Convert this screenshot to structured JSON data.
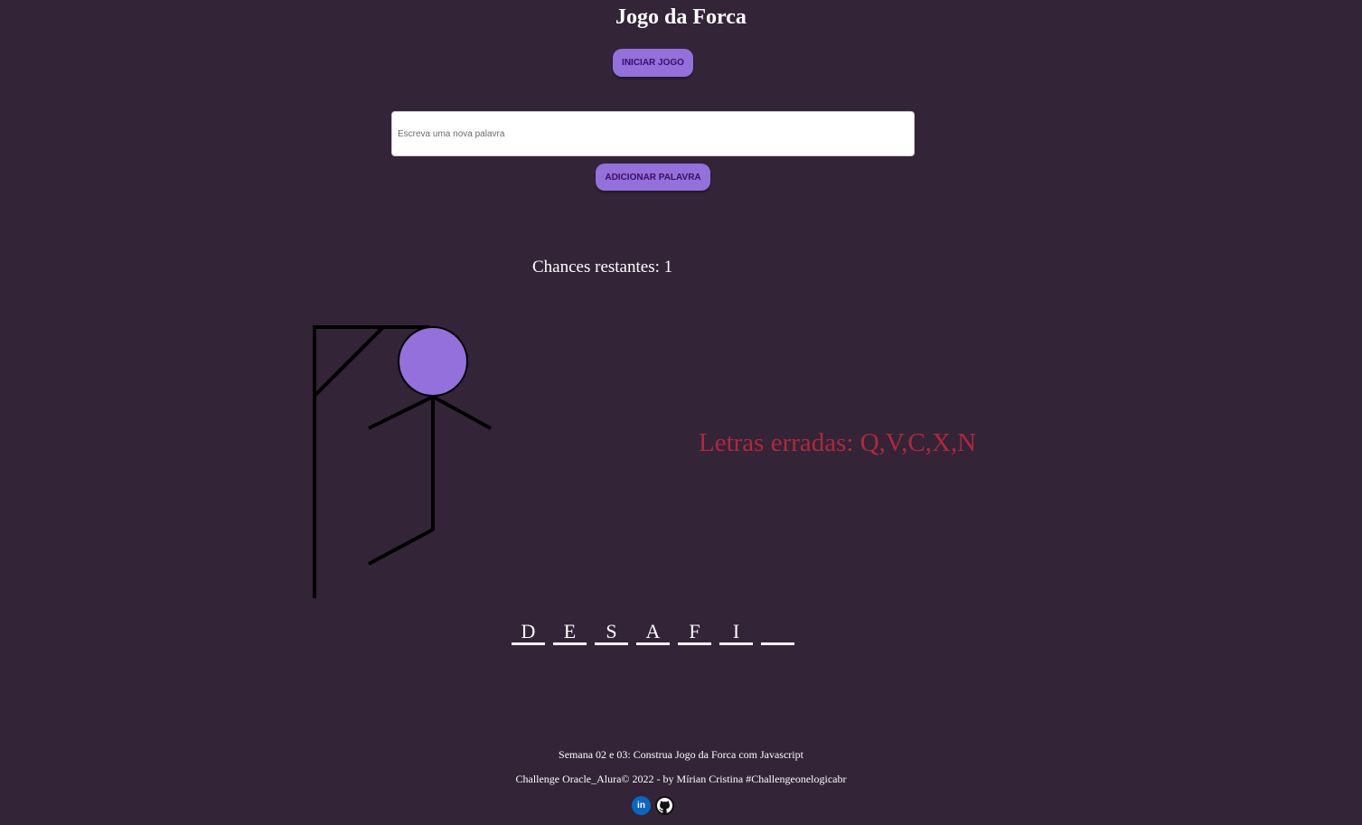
{
  "header": {
    "title": "Jogo da Forca"
  },
  "controls": {
    "start_label": "INICIAR JOGO",
    "word_input_placeholder": "Escreva uma nova palavra",
    "word_input_value": "",
    "add_label": "ADICIONAR PALAVRA"
  },
  "game": {
    "chances_label": "Chances restantes: ",
    "chances_value": "1",
    "wrong_letters_label": "Letras erradas: ",
    "wrong_letters": "Q,V,C,X,N",
    "word_slots": [
      "D",
      "E",
      "S",
      "A",
      "F",
      "I",
      ""
    ]
  },
  "footer": {
    "line1": "Semana 02 e 03: Construa Jogo da Forca com Javascript",
    "line2": "Challenge Oracle_Alura© 2022 - by Mírian Cristina #Challengeonelogicabr",
    "socials": [
      {
        "name": "linkedin-icon",
        "glyph": "in"
      },
      {
        "name": "github-icon",
        "glyph": ""
      }
    ]
  },
  "colors": {
    "background": "#332438",
    "accent": "#9370db",
    "wrong_letters": "#b0283a"
  }
}
